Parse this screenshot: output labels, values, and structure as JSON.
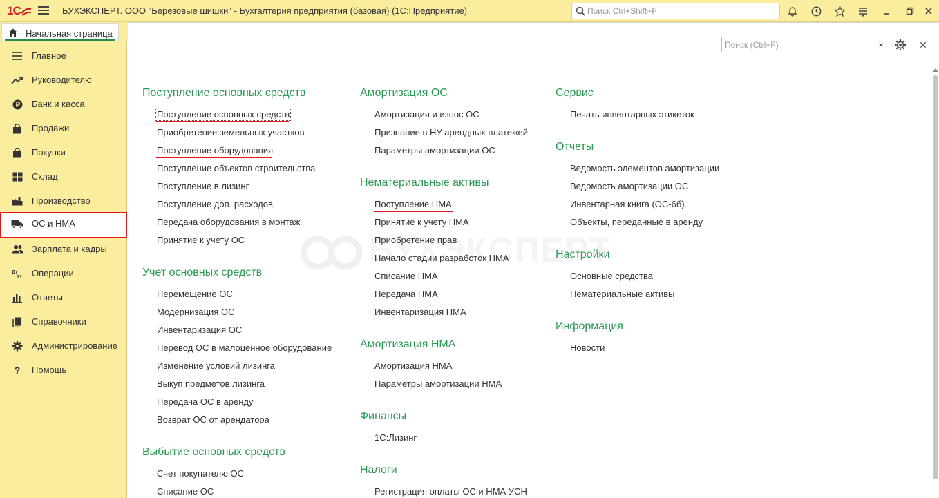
{
  "window": {
    "logo": "1С",
    "title": "БУХЭКСПЕРТ. ООО \"Березовые шишки\" - Бухгалтерия предприятия (базовая)  (1С:Предприятие)",
    "search_placeholder": "Поиск Ctrl+Shift+F"
  },
  "tabs": {
    "home": "Начальная страница"
  },
  "sidebar": {
    "items": [
      {
        "label": "Главное",
        "icon": "menu-lines-icon"
      },
      {
        "label": "Руководителю",
        "icon": "trend-icon"
      },
      {
        "label": "Банк и касса",
        "icon": "ruble-coin-icon"
      },
      {
        "label": "Продажи",
        "icon": "shopping-bag-icon"
      },
      {
        "label": "Покупки",
        "icon": "shopping-cart-icon"
      },
      {
        "label": "Склад",
        "icon": "warehouse-icon"
      },
      {
        "label": "Производство",
        "icon": "factory-icon"
      },
      {
        "label": "ОС и НМА",
        "icon": "truck-icon"
      },
      {
        "label": "Зарплата и кадры",
        "icon": "people-icon"
      },
      {
        "label": "Операции",
        "icon": "dt-kt-icon"
      },
      {
        "label": "Отчеты",
        "icon": "bar-chart-icon"
      },
      {
        "label": "Справочники",
        "icon": "books-icon"
      },
      {
        "label": "Администрирование",
        "icon": "gear-icon"
      },
      {
        "label": "Помощь",
        "icon": "question-icon"
      }
    ],
    "active_index": 7
  },
  "page": {
    "search_placeholder": "Поиск (Ctrl+F)",
    "watermark": "БУХЭКСПЕРТ"
  },
  "columns": {
    "col1": [
      {
        "title": "Поступление основных средств",
        "links": [
          "Поступление основных средств",
          "Приобретение земельных участков",
          "Поступление оборудования",
          "Поступление объектов строительства",
          "Поступление в лизинг",
          "Поступление доп. расходов",
          "Передача оборудования в монтаж",
          "Принятие к учету ОС"
        ]
      },
      {
        "title": "Учет основных средств",
        "links": [
          "Перемещение ОС",
          "Модернизация ОС",
          "Инвентаризация ОС",
          "Перевод ОС в малоценное оборудование",
          "Изменение условий лизинга",
          "Выкуп предметов лизинга",
          "Передача ОС в аренду",
          "Возврат ОС от арендатора"
        ]
      },
      {
        "title": "Выбытие основных средств",
        "links": [
          "Счет покупателю ОС",
          "Списание ОС"
        ]
      }
    ],
    "col2": [
      {
        "title": "Амортизация ОС",
        "links": [
          "Амортизация и износ ОС",
          "Признание в НУ арендных платежей",
          "Параметры амортизации ОС"
        ]
      },
      {
        "title": "Нематериальные активы",
        "links": [
          "Поступление НМА",
          "Принятие к учету НМА",
          "Приобретение прав",
          "Начало стадии разработок НМА",
          "Списание НМА",
          "Передача НМА",
          "Инвентаризация НМА"
        ]
      },
      {
        "title": "Амортизация НМА",
        "links": [
          "Амортизация НМА",
          "Параметры амортизации НМА"
        ]
      },
      {
        "title": "Финансы",
        "links": [
          "1С:Лизинг"
        ]
      },
      {
        "title": "Налоги",
        "links": [
          "Регистрация оплаты ОС и НМА УСН"
        ]
      }
    ],
    "col3": [
      {
        "title": "Сервис",
        "links": [
          "Печать инвентарных этикеток"
        ]
      },
      {
        "title": "Отчеты",
        "links": [
          "Ведомость элементов амортизации",
          "Ведомость амортизации ОС",
          "Инвентарная книга (ОС-6б)",
          "Объекты, переданные в аренду"
        ]
      },
      {
        "title": "Настройки",
        "links": [
          "Основные средства",
          "Нематериальные активы"
        ]
      },
      {
        "title": "Информация",
        "links": [
          "Новости"
        ]
      }
    ]
  },
  "colors": {
    "panel_yellow": "#fbed9e",
    "group_green": "#2a9a53",
    "highlight_red": "#e5151b"
  }
}
